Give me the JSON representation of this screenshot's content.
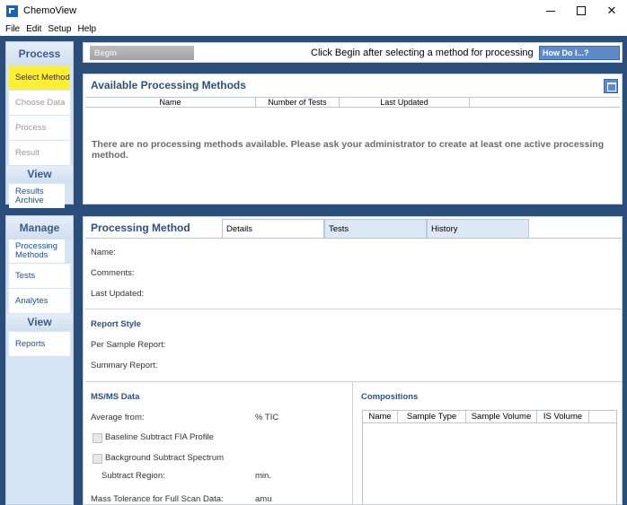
{
  "window": {
    "title": "ChemoView",
    "minimize_glyph": "",
    "maximize_glyph": "",
    "close_glyph": "✕"
  },
  "menu": [
    "File",
    "Edit",
    "Setup",
    "Help"
  ],
  "sidebar": {
    "process_header": "Process",
    "process_items": [
      {
        "label": "Select Method",
        "state": "active"
      },
      {
        "label": "Choose Data",
        "state": "disabled"
      },
      {
        "label": "Process",
        "state": "disabled"
      },
      {
        "label": "Result",
        "state": "disabled"
      }
    ],
    "view_header": "View",
    "view_items": [
      {
        "label": "Results Archive"
      }
    ],
    "manage_header": "Manage",
    "manage_items": [
      {
        "label": "Processing Methods"
      },
      {
        "label": "Tests"
      },
      {
        "label": "Analytes"
      }
    ],
    "manage_view_header": "View",
    "manage_view_items": [
      {
        "label": "Reports"
      }
    ]
  },
  "begin_bar": {
    "begin_label": "Begin",
    "message": "Click Begin after selecting a method for processing",
    "howdo_label": "How Do I...?"
  },
  "methods_panel": {
    "title": "Available Processing Methods",
    "columns": [
      "Name",
      "Number of Tests",
      "Last Updated",
      ""
    ],
    "empty_message": "There are no processing methods available.  Please ask your administrator to create at least one active processing method."
  },
  "processing_panel": {
    "title": "Processing Method",
    "tabs": [
      {
        "label": "Details",
        "active": true
      },
      {
        "label": "Tests",
        "active": false
      },
      {
        "label": "History",
        "active": false
      }
    ],
    "fields": {
      "name": "Name:",
      "comments": "Comments:",
      "last_updated": "Last Updated:"
    },
    "report_style": {
      "title": "Report Style",
      "per_sample": "Per Sample Report:",
      "summary": "Summary Report:"
    },
    "msms": {
      "title": "MS/MS Data",
      "average_from": "Average from:",
      "average_from_value": "% TIC",
      "baseline_subtract": "Baseline Subtract FIA Profile",
      "baseline_checked": false,
      "background_subtract": "Background Subtract Spectrum",
      "background_checked": false,
      "subtract_region": "Subtract Region:",
      "subtract_region_unit": "min.",
      "mass_tolerance": "Mass Tolerance for Full Scan Data:",
      "mass_tolerance_unit": "amu"
    },
    "compositions": {
      "title": "Compositions",
      "columns": [
        "Name",
        "Sample Type",
        "Sample Volume",
        "IS Volume"
      ]
    }
  }
}
